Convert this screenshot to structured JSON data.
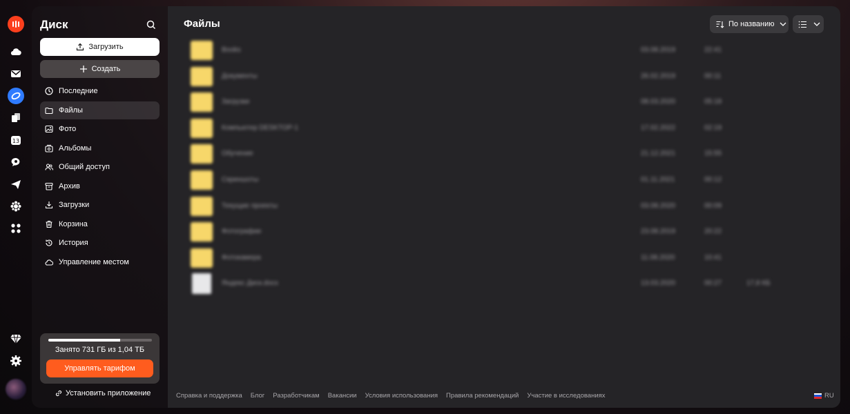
{
  "sidebar": {
    "title": "Диск",
    "upload_label": "Загрузить",
    "create_label": "Создать",
    "nav": [
      {
        "label": "Последние",
        "icon": "clock-icon"
      },
      {
        "label": "Файлы",
        "icon": "folder-icon",
        "active": true
      },
      {
        "label": "Фото",
        "icon": "photo-icon"
      },
      {
        "label": "Альбомы",
        "icon": "albums-icon"
      },
      {
        "label": "Общий доступ",
        "icon": "users-icon"
      },
      {
        "label": "Архив",
        "icon": "archive-icon"
      },
      {
        "label": "Загрузки",
        "icon": "download-icon"
      },
      {
        "label": "Корзина",
        "icon": "trash-icon"
      },
      {
        "label": "История",
        "icon": "history-icon"
      },
      {
        "label": "Управление местом",
        "icon": "cloud-icon"
      }
    ],
    "storage": {
      "text": "Занято 731 ГБ из 1,04 ТБ",
      "used_fraction": 0.69,
      "button_label": "Управлять тарифом"
    },
    "install_label": "Установить приложение"
  },
  "main": {
    "title": "Файлы",
    "sort_label": "По названию",
    "rows": [
      {
        "type": "folder",
        "name": "Books",
        "date": "03.08.2019",
        "time": "22:41",
        "size": ""
      },
      {
        "type": "folder",
        "name": "Документы",
        "date": "26.02.2019",
        "time": "00:11",
        "size": ""
      },
      {
        "type": "folder",
        "name": "Загрузки",
        "date": "08.03.2020",
        "time": "05:18",
        "size": ""
      },
      {
        "type": "folder",
        "name": "Компьютер DESKTOP-1",
        "date": "17.02.2022",
        "time": "02:19",
        "size": ""
      },
      {
        "type": "folder",
        "name": "Обучение",
        "date": "21.12.2021",
        "time": "15:55",
        "size": ""
      },
      {
        "type": "folder",
        "name": "Скриншоты",
        "date": "01.11.2021",
        "time": "00:12",
        "size": ""
      },
      {
        "type": "folder",
        "name": "Текущие проекты",
        "date": "03.08.2020",
        "time": "00:09",
        "size": ""
      },
      {
        "type": "folder",
        "name": "Фотографии",
        "date": "23.08.2019",
        "time": "20:22",
        "size": ""
      },
      {
        "type": "folder",
        "name": "Фотокамера",
        "date": "11.08.2020",
        "time": "10:41",
        "size": ""
      },
      {
        "type": "file",
        "name": "Яндекс Диск.docx",
        "date": "13.03.2020",
        "time": "00:27",
        "size": "17,8 КБ"
      }
    ]
  },
  "footer": {
    "links": [
      "Справка и поддержка",
      "Блог",
      "Разработчикам",
      "Вакансии",
      "Условия использования",
      "Правила рекомендаций",
      "Участие в исследованиях"
    ],
    "lang": "RU"
  },
  "rail": {
    "icons": [
      "yandex-logo-icon",
      "cloud-icon",
      "mail-icon",
      "disk-icon",
      "docs-icon",
      "calendar-icon",
      "messenger-icon",
      "telemost-icon",
      "settings-flower-icon",
      "apps-grid-icon",
      "plus-diamond-icon",
      "gear-icon"
    ],
    "calendar_day": "13"
  }
}
